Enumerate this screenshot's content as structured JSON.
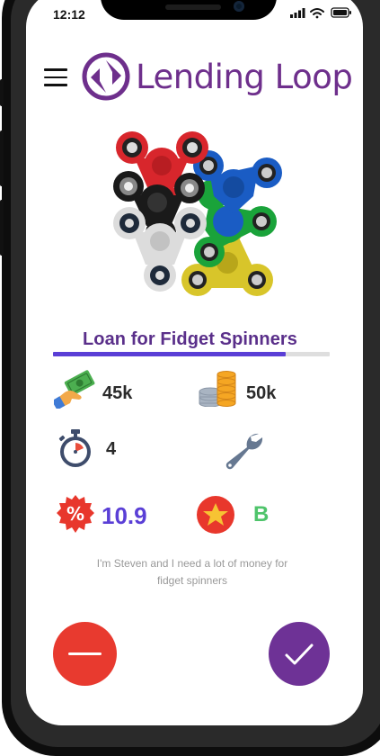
{
  "status_bar": {
    "time": "12:12"
  },
  "app": {
    "brand": "Lending Loop",
    "brand_color": "#6e2f8c"
  },
  "loan": {
    "title": "Loan for Fidget Spinners",
    "funded_fraction": 0.84,
    "amount": "45k",
    "raised": "50k",
    "term": "4",
    "rate": "10.9",
    "grade": "B",
    "description": "I'm Steven and I need a lot of money for fidget spinners"
  },
  "colors": {
    "rate": "#5a3fd6",
    "grade": "#4fc46b",
    "reject": "#e83a2f",
    "accept": "#6e3296",
    "progress": "#5a3fd6"
  },
  "icons": {
    "menu": "hamburger-menu-icon",
    "amount": "money-hand-icon",
    "raised": "coin-stack-icon",
    "term": "stopwatch-icon",
    "tool": "wrench-icon",
    "rate": "percent-badge-icon",
    "grade": "star-badge-icon",
    "reject": "minus-icon",
    "accept": "check-icon"
  }
}
